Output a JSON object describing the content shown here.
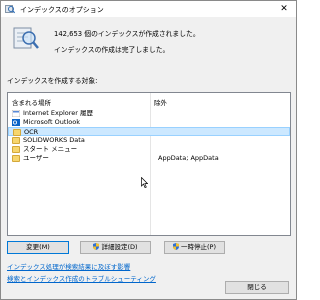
{
  "window": {
    "title": "インデックスのオプション",
    "close_glyph": "✕"
  },
  "status": {
    "line1": "142,653 個のインデックスが作成されました。",
    "line2": "インデックスの作成は完了しました。"
  },
  "section_label": "インデックスを作成する対象:",
  "table": {
    "headers": {
      "location": "含まれる場所",
      "exclude": "除外"
    },
    "rows": [
      {
        "name": "Internet Explorer 履歴",
        "exclude": "",
        "icon": "ie-history-icon"
      },
      {
        "name": "Microsoft Outlook",
        "exclude": "",
        "icon": "outlook-icon"
      },
      {
        "name": "OCR",
        "exclude": "",
        "icon": "folder-icon",
        "selected": true
      },
      {
        "name": "SOLIDWORKS Data",
        "exclude": "",
        "icon": "folder-icon"
      },
      {
        "name": "スタート メニュー",
        "exclude": "",
        "icon": "folder-icon"
      },
      {
        "name": "ユーザー",
        "exclude": "AppData; AppData",
        "icon": "folder-icon"
      }
    ]
  },
  "buttons": {
    "modify": "変更(M)",
    "advanced": "詳細設定(D)",
    "pause": "一時停止(P)",
    "close": "閉じる"
  },
  "links": {
    "search_impact": "インデックス処理が検索結果に及ぼす影響",
    "troubleshoot": "検索とインデックス作成のトラブルシューティング"
  },
  "colors": {
    "accent": "#0078d7",
    "link": "#0066cc",
    "selection": "#cce8ff"
  }
}
